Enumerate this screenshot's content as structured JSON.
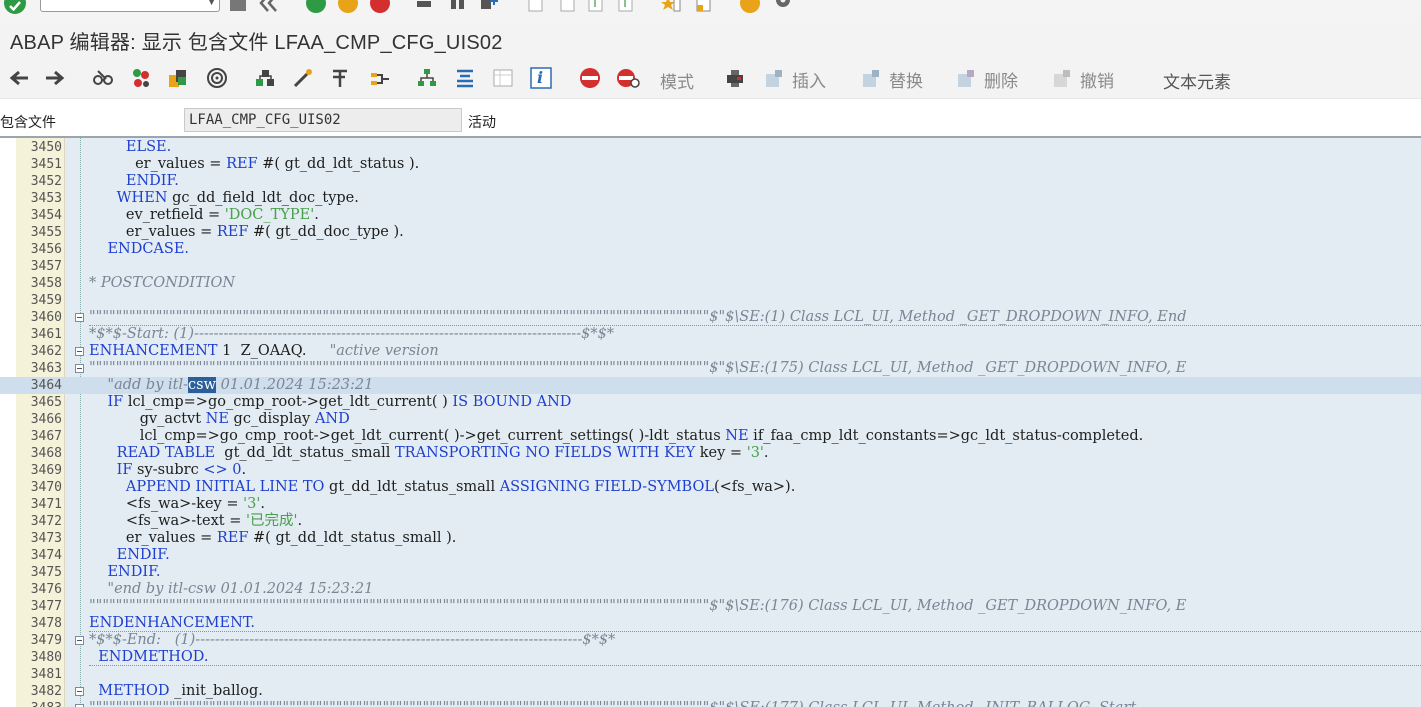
{
  "window": {
    "title": "ABAP 编辑器: 显示 包含文件 LFAA_CMP_CFG_UIS02"
  },
  "toolbar": {
    "mode_label": "模式",
    "insert_label": "插入",
    "replace_label": "替换",
    "delete_label": "删除",
    "undo_label": "撤销",
    "text_elements_label": "文本元素",
    "info_glyph": "i"
  },
  "header": {
    "include_label": "包含文件",
    "include_value": "LFAA_CMP_CFG_UIS02",
    "status": "活动"
  },
  "colors": {
    "editor_bg": "#e2ecf2",
    "gutter_bg": "#f5f2da",
    "keyword": "#1f3fcf",
    "string": "#49a04a",
    "comment": "#7a8595",
    "selection": "#2c5f9a"
  },
  "code": {
    "lines": [
      {
        "n": "3450",
        "fold": false,
        "parts": [
          {
            "t": "        "
          },
          {
            "t": "ELSE.",
            "c": "kw"
          }
        ]
      },
      {
        "n": "3451",
        "fold": false,
        "parts": [
          {
            "t": "          er_values = "
          },
          {
            "t": "REF",
            "c": "kw"
          },
          {
            "t": " #( gt_dd_ldt_status )."
          }
        ]
      },
      {
        "n": "3452",
        "fold": false,
        "parts": [
          {
            "t": "        "
          },
          {
            "t": "ENDIF.",
            "c": "kw"
          }
        ]
      },
      {
        "n": "3453",
        "fold": false,
        "parts": [
          {
            "t": "      "
          },
          {
            "t": "WHEN",
            "c": "kw"
          },
          {
            "t": " gc_dd_field_ldt_doc_type."
          }
        ]
      },
      {
        "n": "3454",
        "fold": false,
        "parts": [
          {
            "t": "        ev_retfield = "
          },
          {
            "t": "'DOC_TYPE'",
            "c": "str"
          },
          {
            "t": "."
          }
        ]
      },
      {
        "n": "3455",
        "fold": false,
        "parts": [
          {
            "t": "        er_values = "
          },
          {
            "t": "REF",
            "c": "kw"
          },
          {
            "t": " #( gt_dd_doc_type )."
          }
        ]
      },
      {
        "n": "3456",
        "fold": false,
        "parts": [
          {
            "t": "    "
          },
          {
            "t": "ENDCASE.",
            "c": "kw"
          }
        ]
      },
      {
        "n": "3457",
        "fold": false,
        "parts": []
      },
      {
        "n": "3458",
        "fold": false,
        "parts": [
          {
            "t": "* POSTCONDITION",
            "c": "cmt"
          }
        ]
      },
      {
        "n": "3459",
        "fold": false,
        "parts": []
      },
      {
        "n": "3460",
        "fold": true,
        "parts": [
          {
            "t": "\"\"\"\"\"\"\"\"\"\"\"\"\"\"\"\"\"\"\"\"\"\"\"\"\"\"\"\"\"\"\"\"\"\"\"\"\"\"\"\"\"\"\"\"\"\"\"\"\"\"\"\"\"\"\"\"\"\"\"\"\"\"\"\"\"\"\"\"\"\"\"\"\"\"\"\"\"\"\"\"\"\"\"\"\"\"\"\"\"\"\"\"\"$\"$\\SE:(1) Class LCL_UI, Method _GET_DROPDOWN_INFO, End",
            "c": "cmt"
          }
        ],
        "dotted": true
      },
      {
        "n": "3461",
        "fold": false,
        "parts": [
          {
            "t": "*$*$-Start: (1)-------------------------------------------------------------------------------$*$*",
            "c": "cmt"
          }
        ]
      },
      {
        "n": "3462",
        "fold": true,
        "parts": [
          {
            "t": "ENHANCEMENT",
            "c": "kw"
          },
          {
            "t": " 1  Z_OAAQ.     "
          },
          {
            "t": "\"active version",
            "c": "cmt"
          }
        ]
      },
      {
        "n": "3463",
        "fold": true,
        "parts": [
          {
            "t": "\"\"\"\"\"\"\"\"\"\"\"\"\"\"\"\"\"\"\"\"\"\"\"\"\"\"\"\"\"\"\"\"\"\"\"\"\"\"\"\"\"\"\"\"\"\"\"\"\"\"\"\"\"\"\"\"\"\"\"\"\"\"\"\"\"\"\"\"\"\"\"\"\"\"\"\"\"\"\"\"\"\"\"\"\"\"\"\"\"\"\"\"\"$\"$\\SE:(175) Class LCL_UI, Method _GET_DROPDOWN_INFO, E",
            "c": "cmt"
          }
        ]
      },
      {
        "n": "3464",
        "fold": false,
        "cur": true,
        "parts": [
          {
            "t": "    \"add by itl-",
            "c": "cmt"
          },
          {
            "t": "csw",
            "c": "sel"
          },
          {
            "t": " 01.01.2024 15:23:21",
            "c": "cmt"
          }
        ]
      },
      {
        "n": "3465",
        "fold": false,
        "parts": [
          {
            "t": "    "
          },
          {
            "t": "IF",
            "c": "kw"
          },
          {
            "t": " lcl_cmp=>go_cmp_root->get_ldt_current( ) "
          },
          {
            "t": "IS BOUND AND",
            "c": "kw"
          }
        ]
      },
      {
        "n": "3466",
        "fold": false,
        "parts": [
          {
            "t": "           gv_actvt "
          },
          {
            "t": "NE",
            "c": "kw"
          },
          {
            "t": " gc_display "
          },
          {
            "t": "AND",
            "c": "kw"
          }
        ]
      },
      {
        "n": "3467",
        "fold": false,
        "parts": [
          {
            "t": "           lcl_cmp=>go_cmp_root->get_ldt_current( )->get_current_settings( )-ldt_status "
          },
          {
            "t": "NE",
            "c": "kw"
          },
          {
            "t": " if_faa_cmp_ldt_constants=>gc_ldt_status-completed."
          }
        ]
      },
      {
        "n": "3468",
        "fold": false,
        "parts": [
          {
            "t": "      "
          },
          {
            "t": "READ TABLE",
            "c": "kw"
          },
          {
            "t": "  gt_dd_ldt_status_small "
          },
          {
            "t": "TRANSPORTING NO FIELDS WITH KEY",
            "c": "kw"
          },
          {
            "t": " key = "
          },
          {
            "t": "'3'",
            "c": "str"
          },
          {
            "t": "."
          }
        ]
      },
      {
        "n": "3469",
        "fold": false,
        "parts": [
          {
            "t": "      "
          },
          {
            "t": "IF",
            "c": "kw"
          },
          {
            "t": " sy-subrc "
          },
          {
            "t": "<> 0",
            "c": "kw"
          },
          {
            "t": "."
          }
        ]
      },
      {
        "n": "3470",
        "fold": false,
        "parts": [
          {
            "t": "        "
          },
          {
            "t": "APPEND INITIAL LINE TO",
            "c": "kw"
          },
          {
            "t": " gt_dd_ldt_status_small "
          },
          {
            "t": "ASSIGNING FIELD-SYMBOL",
            "c": "kw"
          },
          {
            "t": "(<fs_wa>)."
          }
        ]
      },
      {
        "n": "3471",
        "fold": false,
        "parts": [
          {
            "t": "        <fs_wa>-key = "
          },
          {
            "t": "'3'",
            "c": "str"
          },
          {
            "t": "."
          }
        ]
      },
      {
        "n": "3472",
        "fold": false,
        "parts": [
          {
            "t": "        <fs_wa>-text = "
          },
          {
            "t": "'已完成'",
            "c": "str"
          },
          {
            "t": "."
          }
        ]
      },
      {
        "n": "3473",
        "fold": false,
        "parts": [
          {
            "t": "        er_values = "
          },
          {
            "t": "REF",
            "c": "kw"
          },
          {
            "t": " #( gt_dd_ldt_status_small )."
          }
        ]
      },
      {
        "n": "3474",
        "fold": false,
        "parts": [
          {
            "t": "      "
          },
          {
            "t": "ENDIF.",
            "c": "kw"
          }
        ]
      },
      {
        "n": "3475",
        "fold": false,
        "parts": [
          {
            "t": "    "
          },
          {
            "t": "ENDIF.",
            "c": "kw"
          }
        ]
      },
      {
        "n": "3476",
        "fold": false,
        "parts": [
          {
            "t": "    \"end by itl-csw 01.01.2024 15:23:21",
            "c": "cmt"
          }
        ]
      },
      {
        "n": "3477",
        "fold": false,
        "parts": [
          {
            "t": "\"\"\"\"\"\"\"\"\"\"\"\"\"\"\"\"\"\"\"\"\"\"\"\"\"\"\"\"\"\"\"\"\"\"\"\"\"\"\"\"\"\"\"\"\"\"\"\"\"\"\"\"\"\"\"\"\"\"\"\"\"\"\"\"\"\"\"\"\"\"\"\"\"\"\"\"\"\"\"\"\"\"\"\"\"\"\"\"\"\"\"\"\"$\"$\\SE:(176) Class LCL_UI, Method _GET_DROPDOWN_INFO, E",
            "c": "cmt"
          }
        ]
      },
      {
        "n": "3478",
        "fold": false,
        "parts": [
          {
            "t": "ENDENHANCEMENT.",
            "c": "kw"
          }
        ],
        "dotted": true
      },
      {
        "n": "3479",
        "fold": true,
        "parts": [
          {
            "t": "*$*$-End:   (1)-------------------------------------------------------------------------------$*$*",
            "c": "cmt"
          }
        ]
      },
      {
        "n": "3480",
        "fold": false,
        "parts": [
          {
            "t": "  "
          },
          {
            "t": "ENDMETHOD.",
            "c": "kw"
          }
        ],
        "dotted": true
      },
      {
        "n": "3481",
        "fold": false,
        "parts": []
      },
      {
        "n": "3482",
        "fold": true,
        "parts": [
          {
            "t": "  "
          },
          {
            "t": "METHOD",
            "c": "kw"
          },
          {
            "t": " _init_ballog."
          }
        ]
      },
      {
        "n": "3483",
        "fold": true,
        "parts": [
          {
            "t": "\"\"\"\"\"\"\"\"\"\"\"\"\"\"\"\"\"\"\"\"\"\"\"\"\"\"\"\"\"\"\"\"\"\"\"\"\"\"\"\"\"\"\"\"\"\"\"\"\"\"\"\"\"\"\"\"\"\"\"\"\"\"\"\"\"\"\"\"\"\"\"\"\"\"\"\"\"\"\"\"\"\"\"\"\"\"\"\"\"\"\"\"\"$\"$\\SE:(177) Class LCL_UI, Method _INIT_BALLOG, Start",
            "c": "cmt"
          }
        ]
      }
    ]
  }
}
